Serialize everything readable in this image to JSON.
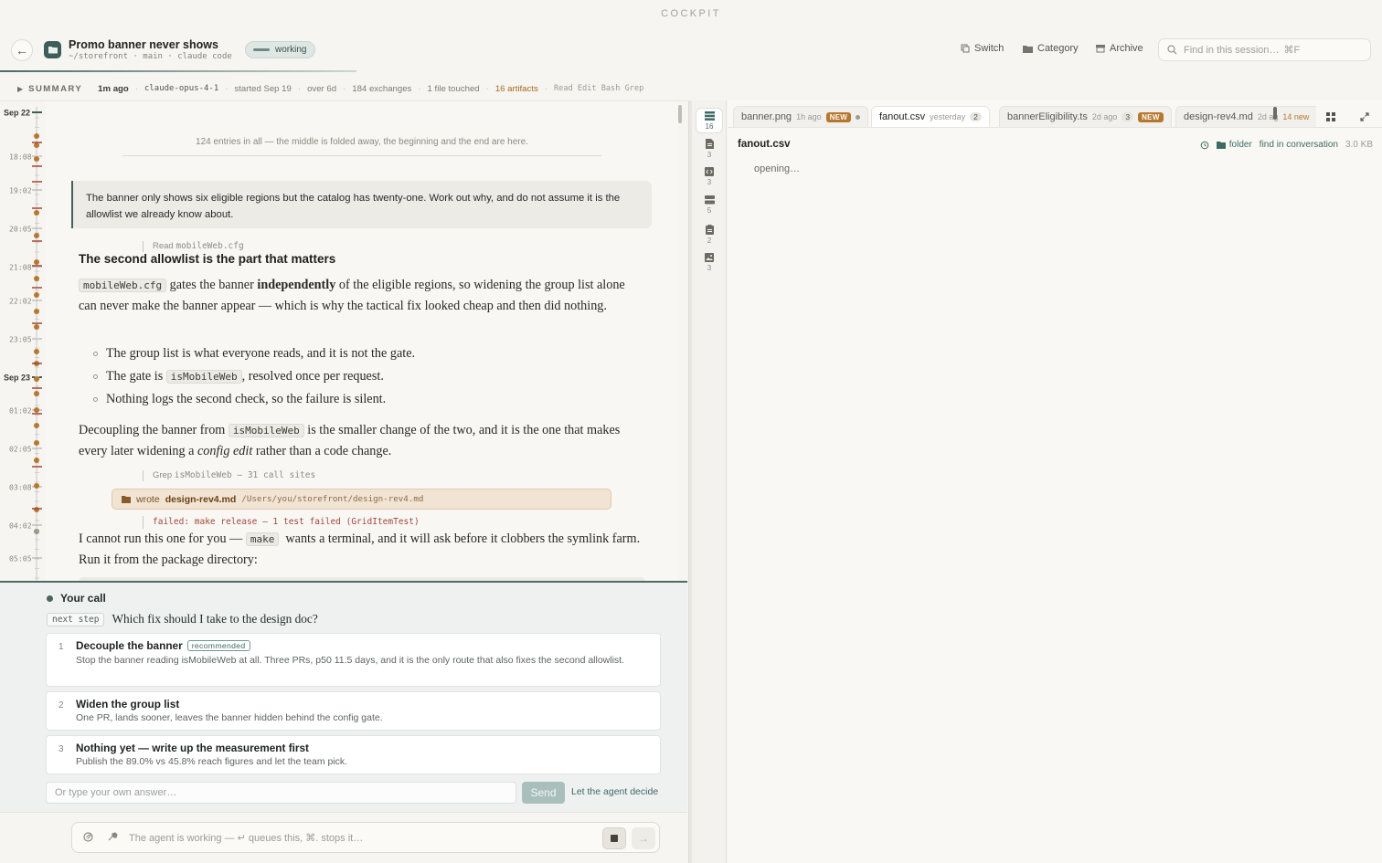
{
  "brand": "COCKPIT",
  "header": {
    "back_glyph": "←",
    "title": "Promo banner never shows",
    "subtitle": "~/storefront · main · claude code",
    "status": "working",
    "actions": {
      "switch": "Switch",
      "category": "Category",
      "archive": "Archive"
    },
    "search_placeholder": "Find in this session…",
    "search_shortcut": "⌘F"
  },
  "summary": {
    "label": "SUMMARY",
    "updated": "1m ago",
    "model": "claude-opus-4-1",
    "started": "started Sep 19",
    "duration": "over 6d",
    "exchanges": "184 exchanges",
    "files": "1 file touched",
    "artifacts": "16 artifacts",
    "tools": "Read Edit Bash Grep"
  },
  "timeline": {
    "labels": [
      "Sep 22",
      "18:08",
      "19:02",
      "20:05",
      "21:08",
      "22:02",
      "23:05",
      "Sep 23",
      "01:02",
      "02:05",
      "03:08",
      "04:02",
      "05:05"
    ]
  },
  "conversation": {
    "fold_note": "124 entries in all — the middle is folded away, the beginning and the end are here.",
    "user_message": "The banner only shows six eligible regions but the catalog has twenty-one. Work out why, and do not assume it is the allowlist we already know about.",
    "tool1": {
      "name": "Read",
      "arg": "mobileWeb.cfg"
    },
    "heading": "The second allowlist is the part that matters",
    "p1": {
      "code": "mobileWeb.cfg",
      "a": " gates the banner ",
      "bold": "independently",
      "b": " of the eligible regions, so widening the group list alone can never make the banner appear — which is why the tactical fix looked cheap and then did nothing."
    },
    "bullets": {
      "b1": "The group list is what everyone reads, and it is not the gate.",
      "b2a": "The gate is ",
      "b2code": "isMobileWeb",
      "b2b": ", resolved once per request.",
      "b3": "Nothing logs the second check, so the failure is silent."
    },
    "p2": {
      "a": "Decoupling the banner from ",
      "code": "isMobileWeb",
      "b": " is the smaller change of the two, and it is the one that makes every later widening a ",
      "em": "config edit",
      "c": " rather than a code change."
    },
    "tool2": {
      "name": "Grep",
      "arg": "isMobileWeb — 31 call sites"
    },
    "wrote": {
      "verb": "wrote",
      "file": "design-rev4.md",
      "path": "/Users/you/storefront/design-rev4.md"
    },
    "failed": "failed: make release — 1 test failed (GridItemTest)",
    "p3": {
      "a": "I cannot run this one for you — ",
      "code": "make",
      "b": " wants a terminal, and it will ask before it clobbers the symlink farm. Run it from the package directory:"
    }
  },
  "decision": {
    "title": "Your call",
    "tag": "next step",
    "question": "Which fix should I take to the design doc?",
    "options": [
      {
        "n": "1",
        "title": "Decouple the banner",
        "badge": "recommended",
        "desc": "Stop the banner reading isMobileWeb at all. Three PRs, p50 11.5 days, and it is the only route that also fixes the second allowlist."
      },
      {
        "n": "2",
        "title": "Widen the group list",
        "badge": "",
        "desc": "One PR, lands sooner, leaves the banner hidden behind the config gate."
      },
      {
        "n": "3",
        "title": "Nothing yet — write up the measurement first",
        "badge": "",
        "desc": "Publish the 89.0% vs 45.8% reach figures and let the team pick."
      }
    ],
    "answer_placeholder": "Or type your own answer…",
    "send": "Send",
    "let_agent": "Let the agent decide"
  },
  "composer": {
    "placeholder": "The agent is working — ↵ queues this, ⌘. stops it…"
  },
  "rail": {
    "items": [
      {
        "icon": "all-artifacts-icon",
        "count": "16"
      },
      {
        "icon": "document-icon",
        "count": "3"
      },
      {
        "icon": "code-icon",
        "count": "3"
      },
      {
        "icon": "table-icon",
        "count": "5"
      },
      {
        "icon": "clipboard-icon",
        "count": "2"
      },
      {
        "icon": "image-icon",
        "count": "3"
      }
    ]
  },
  "tabs": [
    {
      "name": "banner.png",
      "ago": "1h ago",
      "new": "NEW",
      "count": ""
    },
    {
      "name": "fanout.csv",
      "ago": "yesterday",
      "new": "",
      "count": "2"
    },
    {
      "name": "bannerEligibility.ts",
      "ago": "2d ago",
      "new": "NEW",
      "count": "3"
    },
    {
      "name": "design-rev4.md",
      "ago": "2d ag",
      "new": "",
      "count": "",
      "newcount": "14 new"
    }
  ],
  "file": {
    "name": "fanout.csv",
    "folder": "folder",
    "find": "find in conversation",
    "size": "3.0 KB",
    "status": "opening…"
  },
  "colors": {
    "accent": "#4c6b66",
    "artifact": "#b8772e",
    "error": "#a3473b"
  }
}
